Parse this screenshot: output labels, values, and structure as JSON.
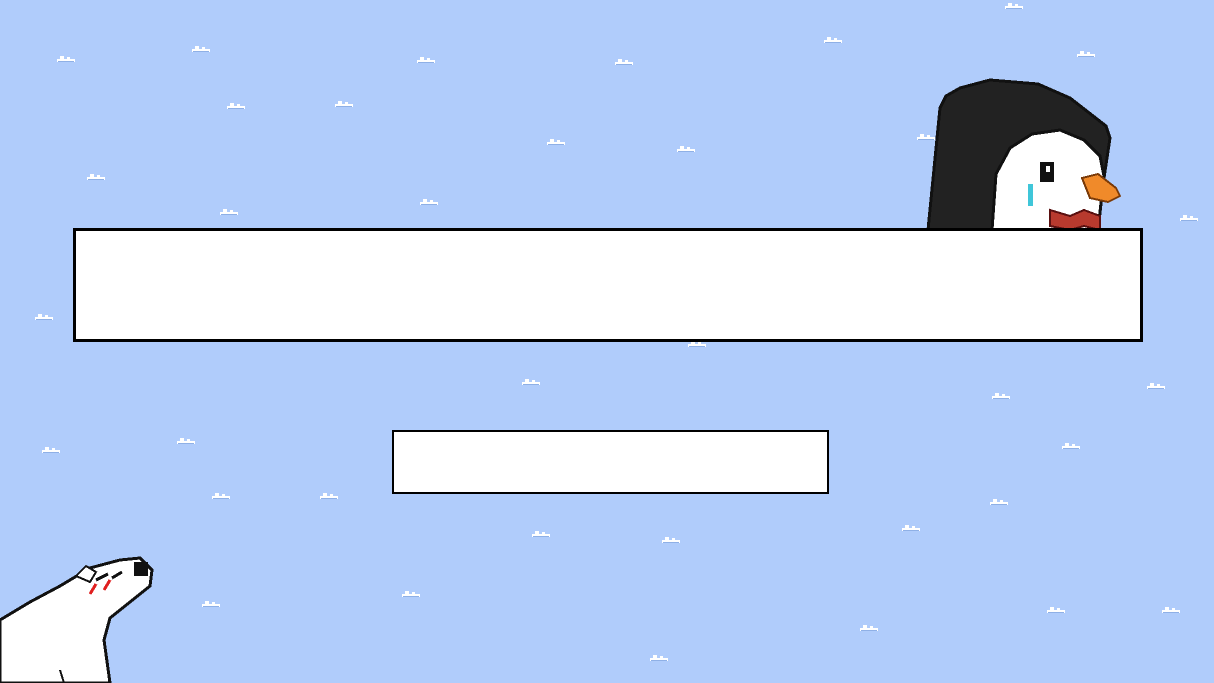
{
  "game": {
    "title_text": "",
    "button_label": ""
  },
  "colors": {
    "sky": "#b0ccfb",
    "panel_fill": "#ffffff",
    "panel_border": "#000000",
    "snow": "#ffffff",
    "penguin_body": "#222222",
    "penguin_beak": "#f08a2a",
    "penguin_bowtie": "#b83a2e",
    "penguin_tear": "#3fc6d9",
    "bear_cheeks": "#e02020"
  },
  "icons": {
    "penguin": "penguin-sprite",
    "bear": "polar-bear-sprite",
    "snowdrift": "snow-drift-icon"
  }
}
